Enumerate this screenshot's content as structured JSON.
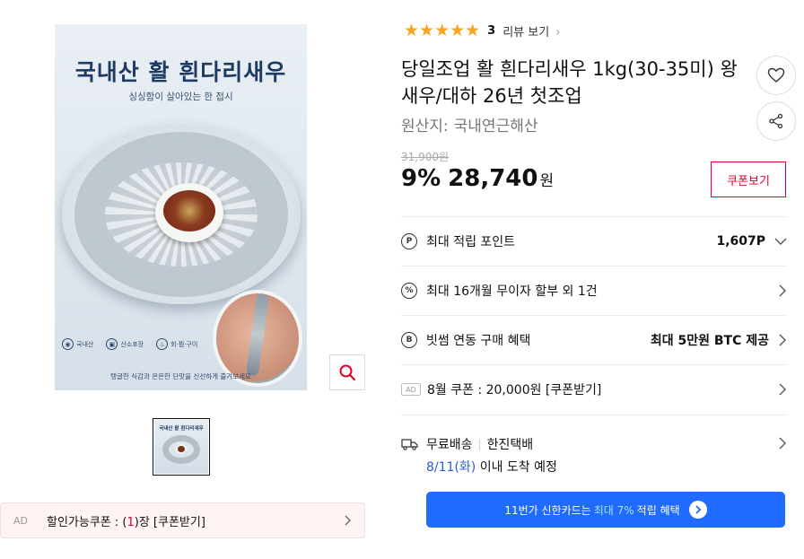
{
  "image": {
    "title": "국내산 활 흰다리새우",
    "subtitle": "싱싱함이 살아있는 한 접시",
    "badges": [
      "국내산",
      "산소포장",
      "회·찜·구이"
    ],
    "caption": "탱글한 식감과 은은한 단맛을 신선하게 즐겨보세요",
    "thumb_title": "국내산 활 흰다리새우"
  },
  "rating": {
    "stars": "★★★★★",
    "count": "3",
    "review_link": "리뷰 보기"
  },
  "product": {
    "title": "당일조업 활 흰다리새우 1kg(30-35미) 왕새우/대하 26년 첫조업",
    "origin_label": "원산지:",
    "origin_value": "국내연근해산"
  },
  "price": {
    "original": "31,900원",
    "discount": "9%",
    "sale": "28,740",
    "unit": "원",
    "coupon_button": "쿠폰보기"
  },
  "benefits": [
    {
      "icon": "P",
      "label": "최대 적립 포인트",
      "value": "1,607P"
    },
    {
      "icon": "%",
      "label": "최대 16개월 무이자 할부 외 1건",
      "value": ""
    },
    {
      "icon": "B",
      "label": "빗썸 연동 구매 혜택",
      "value": "최대 5만원 BTC 제공"
    },
    {
      "icon": "AD",
      "label": "8월 쿠폰 : 20,000원 [쿠폰받기]",
      "value": ""
    }
  ],
  "shipping": {
    "type": "무료배송",
    "carrier": "한진택배",
    "date": "8/11(화)",
    "eta_suffix": "이내 도착 예정"
  },
  "card_banner": {
    "prefix": "11번가 신한카드는",
    "highlight": "최대 7%",
    "suffix": "적립 혜택"
  },
  "coupon_bar": {
    "ad": "AD",
    "text_prefix": "할인가능쿠폰 : (",
    "count": "1",
    "text_suffix": ")장 [쿠폰받기]"
  },
  "colors": {
    "accent_red": "#e4002b",
    "star": "#f5a623",
    "banner_blue": "#1f6aff",
    "delivery_blue": "#2a5bd7"
  }
}
